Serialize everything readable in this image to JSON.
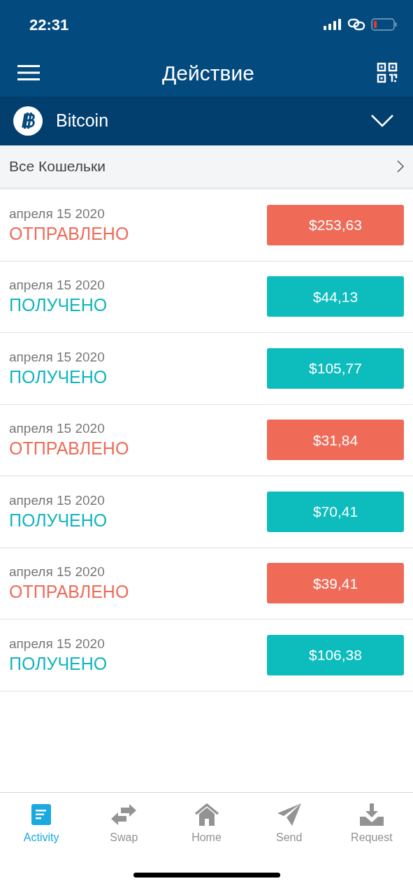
{
  "status_bar": {
    "time": "22:31"
  },
  "header": {
    "title": "Действие"
  },
  "coin": {
    "name": "Bitcoin"
  },
  "wallets": {
    "label": "Все Кошельки"
  },
  "transactions": [
    {
      "date": "апреля 15 2020",
      "kind": "sent",
      "status": "ОТПРАВЛЕНО",
      "amount": "$253,63"
    },
    {
      "date": "апреля 15 2020",
      "kind": "received",
      "status": "ПОЛУЧЕНО",
      "amount": "$44,13"
    },
    {
      "date": "апреля 15 2020",
      "kind": "received",
      "status": "ПОЛУЧЕНО",
      "amount": "$105,77"
    },
    {
      "date": "апреля 15 2020",
      "kind": "sent",
      "status": "ОТПРАВЛЕНО",
      "amount": "$31,84"
    },
    {
      "date": "апреля 15 2020",
      "kind": "received",
      "status": "ПОЛУЧЕНО",
      "amount": "$70,41"
    },
    {
      "date": "апреля 15 2020",
      "kind": "sent",
      "status": "ОТПРАВЛЕНО",
      "amount": "$39,41"
    },
    {
      "date": "апреля 15 2020",
      "kind": "received",
      "status": "ПОЛУЧЕНО",
      "amount": "$106,38"
    }
  ],
  "tabs": [
    {
      "kind": "activity",
      "label": "Activity",
      "selected": true
    },
    {
      "kind": "swap",
      "label": "Swap",
      "selected": false
    },
    {
      "kind": "home",
      "label": "Home",
      "selected": false
    },
    {
      "kind": "send",
      "label": "Send",
      "selected": false
    },
    {
      "kind": "request",
      "label": "Request",
      "selected": false
    }
  ]
}
